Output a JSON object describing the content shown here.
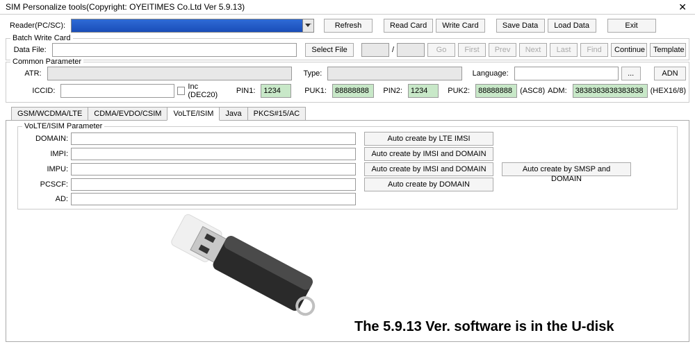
{
  "titlebar": {
    "text": "SIM Personalize tools(Copyright: OYEITIMES Co.Ltd  Ver 5.9.13)"
  },
  "reader": {
    "label": "Reader(PC/SC):",
    "btn_refresh": "Refresh",
    "btn_readcard": "Read Card",
    "btn_writecard": "Write Card",
    "btn_savedata": "Save Data",
    "btn_loaddata": "Load Data",
    "btn_exit": "Exit"
  },
  "batch": {
    "legend": "Batch Write Card",
    "datafile_label": "Data File:",
    "btn_selectfile": "Select File",
    "slash": "/",
    "btn_go": "Go",
    "btn_first": "First",
    "btn_prev": "Prev",
    "btn_next": "Next",
    "btn_last": "Last",
    "btn_find": "Find",
    "btn_continue": "Continue",
    "btn_template": "Template"
  },
  "common": {
    "legend": "Common Parameter",
    "atr_label": "ATR:",
    "type_label": "Type:",
    "language_label": "Language:",
    "dots": "...",
    "btn_adn": "ADN",
    "iccid_label": "ICCID:",
    "inc_label": "Inc  (DEC20)",
    "pin1_label": "PIN1:",
    "pin1_value": "1234",
    "puk1_label": "PUK1:",
    "puk1_value": "88888888",
    "pin2_label": "PIN2:",
    "pin2_value": "1234",
    "puk2_label": "PUK2:",
    "puk2_value": "88888888",
    "asc8_label": "(ASC8)",
    "adm_label": "ADM:",
    "adm_value": "3838383838383838",
    "hex_label": "(HEX16/8)"
  },
  "tabs": {
    "t1": "GSM/WCDMA/LTE",
    "t2": "CDMA/EVDO/CSIM",
    "t3": "VoLTE/ISIM",
    "t4": "Java",
    "t5": "PKCS#15/AC"
  },
  "volte": {
    "legend": "VoLTE/ISIM  Parameter",
    "domain_label": "DOMAIN:",
    "impi_label": "IMPI:",
    "impu_label": "IMPU:",
    "pcscf_label": "PCSCF:",
    "ad_label": "AD:",
    "btn_lte_imsi": "Auto create by LTE IMSI",
    "btn_imsi_domain": "Auto create by IMSI and DOMAIN",
    "btn_imsi_domain2": "Auto create by IMSI and DOMAIN",
    "btn_smsp_domain": "Auto create by SMSP and DOMAIN",
    "btn_domain": "Auto create by DOMAIN"
  },
  "caption": "The 5.9.13 Ver. software is in the U-disk"
}
